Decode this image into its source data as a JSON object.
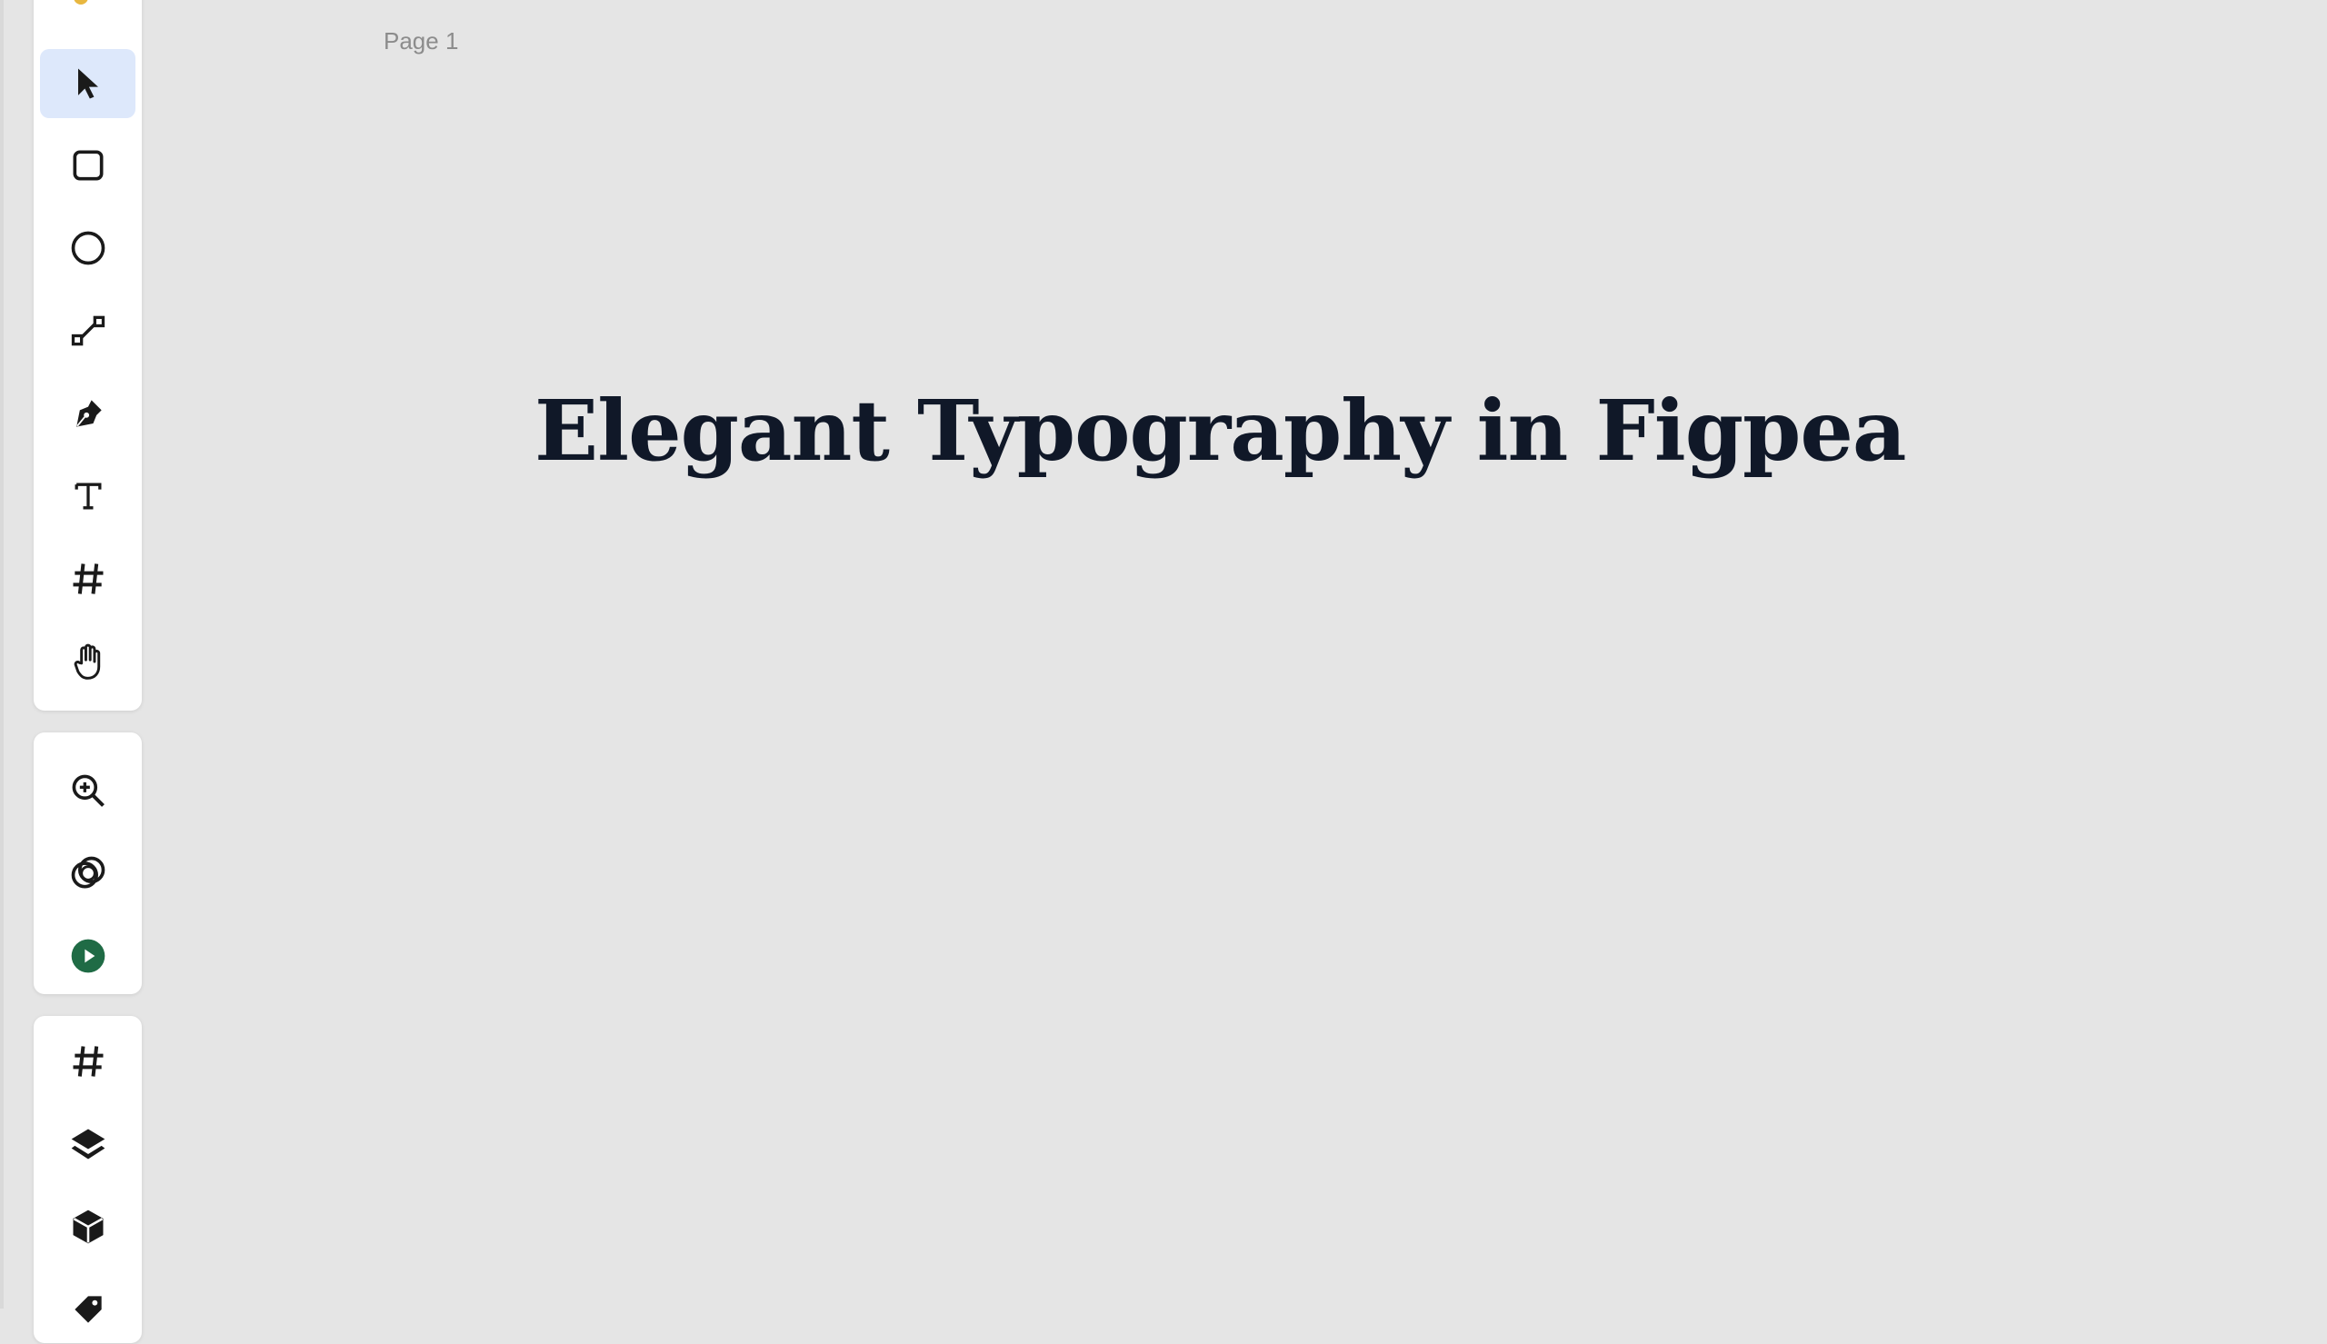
{
  "canvas": {
    "page_label": "Page 1",
    "headline": "Elegant Typography in Figpea",
    "background": "#e5e5e5",
    "text_color": "#101828"
  },
  "toolbar": {
    "active_tool": "move",
    "accent": "#dde8fb",
    "tools": [
      {
        "name": "move",
        "icon": "cursor-arrow-icon"
      },
      {
        "name": "rectangle",
        "icon": "rounded-square-icon"
      },
      {
        "name": "ellipse",
        "icon": "circle-icon"
      },
      {
        "name": "line",
        "icon": "line-icon"
      },
      {
        "name": "pen",
        "icon": "pen-nib-icon"
      },
      {
        "name": "text",
        "icon": "text-t-icon"
      },
      {
        "name": "frame",
        "icon": "hash-icon"
      },
      {
        "name": "hand",
        "icon": "hand-icon"
      }
    ],
    "secondary_tools": [
      {
        "name": "zoom",
        "icon": "zoom-in-icon"
      },
      {
        "name": "boolean",
        "icon": "interlocked-rings-icon"
      },
      {
        "name": "present",
        "icon": "play-circle-icon",
        "color": "#1f6b45"
      }
    ],
    "panels": [
      {
        "name": "frames",
        "icon": "hash-icon"
      },
      {
        "name": "layers",
        "icon": "layers-icon"
      },
      {
        "name": "components",
        "icon": "cube-icon"
      },
      {
        "name": "assets",
        "icon": "tag-icon"
      }
    ]
  }
}
